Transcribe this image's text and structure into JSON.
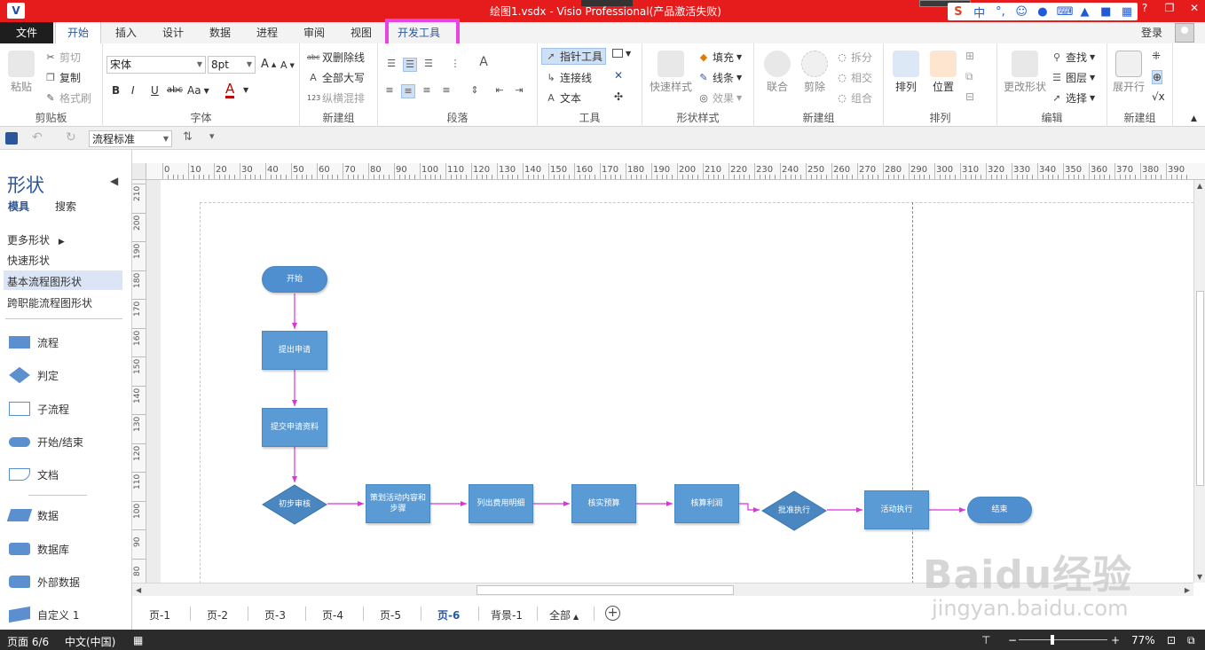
{
  "titlebar": {
    "app_icon": "V",
    "title": "绘图1.vsdx - Visio Professional(产品激活失败)",
    "ime_icons": [
      "sogou-icon",
      "中",
      "°,",
      "emoji-icon",
      "mic-icon",
      "keyboard-icon",
      "skin-icon",
      "shirt-icon",
      "grid-icon"
    ],
    "ime_labels": [
      "S",
      "中",
      "°,",
      "☺",
      "🎤",
      "⌨",
      "👕",
      "👤",
      "▦"
    ],
    "controls": [
      "?",
      "▭",
      "—",
      "❐",
      "✕"
    ]
  },
  "tabs": {
    "file": "文件",
    "home": "开始",
    "insert": "插入",
    "design": "设计",
    "data": "数据",
    "process": "进程",
    "review": "审阅",
    "view": "视图",
    "developer": "开发工具",
    "login": "登录"
  },
  "ribbon": {
    "clipboard": {
      "label": "剪贴板",
      "paste": "粘贴",
      "cut": "剪切",
      "copy": "复制",
      "format_painter": "格式刷"
    },
    "font": {
      "label": "字体",
      "font_name": "宋体",
      "font_size": "8pt",
      "bold": "B",
      "italic": "I",
      "underline": "U",
      "strike": "abc",
      "case": "Aa",
      "color": "A"
    },
    "new_group1": {
      "label": "新建组",
      "double_strike": "双删除线",
      "all_caps": "全部大写",
      "vertical": "纵横混排"
    },
    "paragraph": {
      "label": "段落"
    },
    "tools": {
      "label": "工具",
      "pointer": "指针工具",
      "connector": "连接线",
      "text": "文本"
    },
    "shape_styles": {
      "label": "形状样式",
      "quick_styles": "快速样式",
      "fill": "填充",
      "line": "线条",
      "effects": "效果"
    },
    "new_group2": {
      "label": "新建组",
      "union": "联合",
      "fragment": "剪除",
      "split": "拆分",
      "intersect": "相交",
      "combine": "组合"
    },
    "arrange": {
      "label": "排列",
      "arrange_btn": "排列",
      "position": "位置"
    },
    "edit": {
      "label": "编辑",
      "change_shape": "更改形状",
      "find": "查找",
      "layers": "图层",
      "select": "选择"
    },
    "new_group3": {
      "label": "新建组",
      "expand_row": "展开行"
    }
  },
  "qat": {
    "style_combo": "流程标准"
  },
  "shapes_pane": {
    "title": "形状",
    "tab_stencil": "模具",
    "tab_search": "搜索",
    "more_shapes": "更多形状",
    "quick_shapes": "快速形状",
    "basic_flowchart": "基本流程图形状",
    "cross_functional": "跨职能流程图形状",
    "items": [
      "流程",
      "判定",
      "子流程",
      "开始/结束",
      "文档",
      "数据",
      "数据库",
      "外部数据",
      "自定义 1"
    ]
  },
  "ruler": {
    "top": [
      "0",
      "10",
      "20",
      "30",
      "40",
      "50",
      "60",
      "70",
      "80",
      "90",
      "100",
      "110",
      "120",
      "130",
      "140",
      "150",
      "160",
      "170",
      "180",
      "190",
      "200",
      "210",
      "220",
      "230",
      "240",
      "250",
      "260",
      "270",
      "280",
      "290",
      "300",
      "310",
      "320",
      "330",
      "340",
      "350",
      "360",
      "370",
      "380",
      "390"
    ],
    "left": [
      "210",
      "200",
      "190",
      "180",
      "170",
      "160",
      "150",
      "140",
      "130",
      "120",
      "110",
      "100",
      "90",
      "80"
    ]
  },
  "flowchart": {
    "start": "开始",
    "step1": "提出申请",
    "step2": "提交申请资料",
    "decision1": "初步审核",
    "step3": "策划活动内容和步骤",
    "step4": "列出费用明细",
    "step5": "核实预算",
    "step6": "核算利润",
    "decision2": "批准执行",
    "step7": "活动执行",
    "end": "结束",
    "connector_color": "#e030e0",
    "shape_color": "#5b9bd5"
  },
  "page_tabs": [
    "页-1",
    "页-2",
    "页-3",
    "页-4",
    "页-5",
    "页-6",
    "背景-1",
    "全部"
  ],
  "active_page_tab": "页-6",
  "statusbar": {
    "page": "页面 6/6",
    "language": "中文(中国)",
    "zoom": "77%"
  },
  "watermark": {
    "main": "Baidu经验",
    "sub": "jingyan.baidu.com"
  },
  "colors": {
    "titlebar": "#e61c1c",
    "accent": "#2b579a",
    "highlight": "#e744e7"
  }
}
